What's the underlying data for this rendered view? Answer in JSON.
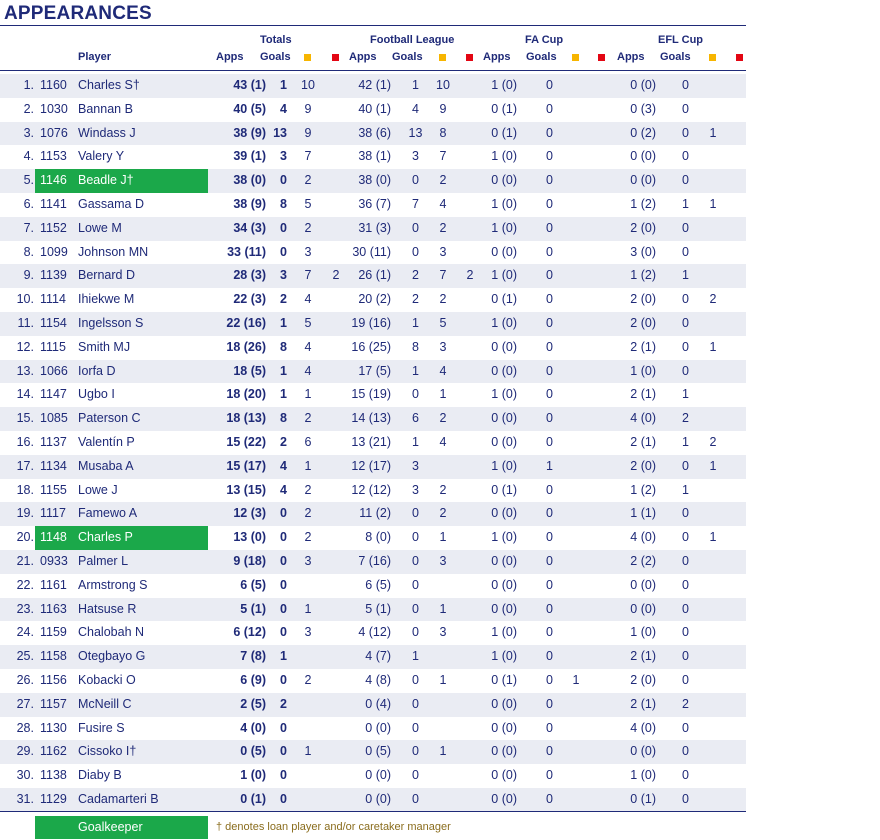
{
  "title": "APPEARANCES",
  "groups": {
    "totals": "Totals",
    "league": "Football League",
    "facup": "FA Cup",
    "eflcup": "EFL Cup"
  },
  "headers": {
    "player": "Player",
    "apps": "Apps",
    "goals": "Goals"
  },
  "colors": {
    "text": "#1f2a78",
    "goalkeeper": "#1ba84a",
    "alt_row": "#eaecf3",
    "yellow_card": "#f7b500",
    "red_card": "#e30613",
    "note": "#8a6d1e"
  },
  "legend": {
    "goalkeeper": "Goalkeeper",
    "note": "† denotes loan player and/or caretaker manager"
  },
  "rows": [
    {
      "num": "1.",
      "code": "1160",
      "player": "Charles S†",
      "gk": false,
      "t_apps": "43 (1)",
      "t_goals": "1",
      "t_y": "10",
      "t_r": "",
      "l_apps": "42 (1)",
      "l_goals": "1",
      "l_y": "10",
      "l_r": "",
      "f_apps": "1 (0)",
      "f_goals": "0",
      "f_y": "",
      "f_r": "",
      "e_apps": "0 (0)",
      "e_goals": "0",
      "e_y": "",
      "e_r": ""
    },
    {
      "num": "2.",
      "code": "1030",
      "player": "Bannan B",
      "gk": false,
      "t_apps": "40 (5)",
      "t_goals": "4",
      "t_y": "9",
      "t_r": "",
      "l_apps": "40 (1)",
      "l_goals": "4",
      "l_y": "9",
      "l_r": "",
      "f_apps": "0 (1)",
      "f_goals": "0",
      "f_y": "",
      "f_r": "",
      "e_apps": "0 (3)",
      "e_goals": "0",
      "e_y": "",
      "e_r": ""
    },
    {
      "num": "3.",
      "code": "1076",
      "player": "Windass J",
      "gk": false,
      "t_apps": "38 (9)",
      "t_goals": "13",
      "t_y": "9",
      "t_r": "",
      "l_apps": "38 (6)",
      "l_goals": "13",
      "l_y": "8",
      "l_r": "",
      "f_apps": "0 (1)",
      "f_goals": "0",
      "f_y": "",
      "f_r": "",
      "e_apps": "0 (2)",
      "e_goals": "0",
      "e_y": "1",
      "e_r": ""
    },
    {
      "num": "4.",
      "code": "1153",
      "player": "Valery Y",
      "gk": false,
      "t_apps": "39 (1)",
      "t_goals": "3",
      "t_y": "7",
      "t_r": "",
      "l_apps": "38 (1)",
      "l_goals": "3",
      "l_y": "7",
      "l_r": "",
      "f_apps": "1 (0)",
      "f_goals": "0",
      "f_y": "",
      "f_r": "",
      "e_apps": "0 (0)",
      "e_goals": "0",
      "e_y": "",
      "e_r": ""
    },
    {
      "num": "5.",
      "code": "1146",
      "player": "Beadle J†",
      "gk": true,
      "t_apps": "38 (0)",
      "t_goals": "0",
      "t_y": "2",
      "t_r": "",
      "l_apps": "38 (0)",
      "l_goals": "0",
      "l_y": "2",
      "l_r": "",
      "f_apps": "0 (0)",
      "f_goals": "0",
      "f_y": "",
      "f_r": "",
      "e_apps": "0 (0)",
      "e_goals": "0",
      "e_y": "",
      "e_r": ""
    },
    {
      "num": "6.",
      "code": "1141",
      "player": "Gassama D",
      "gk": false,
      "t_apps": "38 (9)",
      "t_goals": "8",
      "t_y": "5",
      "t_r": "",
      "l_apps": "36 (7)",
      "l_goals": "7",
      "l_y": "4",
      "l_r": "",
      "f_apps": "1 (0)",
      "f_goals": "0",
      "f_y": "",
      "f_r": "",
      "e_apps": "1 (2)",
      "e_goals": "1",
      "e_y": "1",
      "e_r": ""
    },
    {
      "num": "7.",
      "code": "1152",
      "player": "Lowe M",
      "gk": false,
      "t_apps": "34 (3)",
      "t_goals": "0",
      "t_y": "2",
      "t_r": "",
      "l_apps": "31 (3)",
      "l_goals": "0",
      "l_y": "2",
      "l_r": "",
      "f_apps": "1 (0)",
      "f_goals": "0",
      "f_y": "",
      "f_r": "",
      "e_apps": "2 (0)",
      "e_goals": "0",
      "e_y": "",
      "e_r": ""
    },
    {
      "num": "8.",
      "code": "1099",
      "player": "Johnson MN",
      "gk": false,
      "t_apps": "33 (11)",
      "t_goals": "0",
      "t_y": "3",
      "t_r": "",
      "l_apps": "30 (11)",
      "l_goals": "0",
      "l_y": "3",
      "l_r": "",
      "f_apps": "0 (0)",
      "f_goals": "0",
      "f_y": "",
      "f_r": "",
      "e_apps": "3 (0)",
      "e_goals": "0",
      "e_y": "",
      "e_r": ""
    },
    {
      "num": "9.",
      "code": "1139",
      "player": "Bernard D",
      "gk": false,
      "t_apps": "28 (3)",
      "t_goals": "3",
      "t_y": "7",
      "t_r": "2",
      "l_apps": "26 (1)",
      "l_goals": "2",
      "l_y": "7",
      "l_r": "2",
      "f_apps": "1 (0)",
      "f_goals": "0",
      "f_y": "",
      "f_r": "",
      "e_apps": "1 (2)",
      "e_goals": "1",
      "e_y": "",
      "e_r": ""
    },
    {
      "num": "10.",
      "code": "1114",
      "player": "Ihiekwe M",
      "gk": false,
      "t_apps": "22 (3)",
      "t_goals": "2",
      "t_y": "4",
      "t_r": "",
      "l_apps": "20 (2)",
      "l_goals": "2",
      "l_y": "2",
      "l_r": "",
      "f_apps": "0 (1)",
      "f_goals": "0",
      "f_y": "",
      "f_r": "",
      "e_apps": "2 (0)",
      "e_goals": "0",
      "e_y": "2",
      "e_r": ""
    },
    {
      "num": "11.",
      "code": "1154",
      "player": "Ingelsson S",
      "gk": false,
      "t_apps": "22 (16)",
      "t_goals": "1",
      "t_y": "5",
      "t_r": "",
      "l_apps": "19 (16)",
      "l_goals": "1",
      "l_y": "5",
      "l_r": "",
      "f_apps": "1 (0)",
      "f_goals": "0",
      "f_y": "",
      "f_r": "",
      "e_apps": "2 (0)",
      "e_goals": "0",
      "e_y": "",
      "e_r": ""
    },
    {
      "num": "12.",
      "code": "1115",
      "player": "Smith MJ",
      "gk": false,
      "t_apps": "18 (26)",
      "t_goals": "8",
      "t_y": "4",
      "t_r": "",
      "l_apps": "16 (25)",
      "l_goals": "8",
      "l_y": "3",
      "l_r": "",
      "f_apps": "0 (0)",
      "f_goals": "0",
      "f_y": "",
      "f_r": "",
      "e_apps": "2 (1)",
      "e_goals": "0",
      "e_y": "1",
      "e_r": ""
    },
    {
      "num": "13.",
      "code": "1066",
      "player": "Iorfa D",
      "gk": false,
      "t_apps": "18 (5)",
      "t_goals": "1",
      "t_y": "4",
      "t_r": "",
      "l_apps": "17 (5)",
      "l_goals": "1",
      "l_y": "4",
      "l_r": "",
      "f_apps": "0 (0)",
      "f_goals": "0",
      "f_y": "",
      "f_r": "",
      "e_apps": "1 (0)",
      "e_goals": "0",
      "e_y": "",
      "e_r": ""
    },
    {
      "num": "14.",
      "code": "1147",
      "player": "Ugbo I",
      "gk": false,
      "t_apps": "18 (20)",
      "t_goals": "1",
      "t_y": "1",
      "t_r": "",
      "l_apps": "15 (19)",
      "l_goals": "0",
      "l_y": "1",
      "l_r": "",
      "f_apps": "1 (0)",
      "f_goals": "0",
      "f_y": "",
      "f_r": "",
      "e_apps": "2 (1)",
      "e_goals": "1",
      "e_y": "",
      "e_r": ""
    },
    {
      "num": "15.",
      "code": "1085",
      "player": "Paterson C",
      "gk": false,
      "t_apps": "18 (13)",
      "t_goals": "8",
      "t_y": "2",
      "t_r": "",
      "l_apps": "14 (13)",
      "l_goals": "6",
      "l_y": "2",
      "l_r": "",
      "f_apps": "0 (0)",
      "f_goals": "0",
      "f_y": "",
      "f_r": "",
      "e_apps": "4 (0)",
      "e_goals": "2",
      "e_y": "",
      "e_r": ""
    },
    {
      "num": "16.",
      "code": "1137",
      "player": "Valentín P",
      "gk": false,
      "t_apps": "15 (22)",
      "t_goals": "2",
      "t_y": "6",
      "t_r": "",
      "l_apps": "13 (21)",
      "l_goals": "1",
      "l_y": "4",
      "l_r": "",
      "f_apps": "0 (0)",
      "f_goals": "0",
      "f_y": "",
      "f_r": "",
      "e_apps": "2 (1)",
      "e_goals": "1",
      "e_y": "2",
      "e_r": ""
    },
    {
      "num": "17.",
      "code": "1134",
      "player": "Musaba A",
      "gk": false,
      "t_apps": "15 (17)",
      "t_goals": "4",
      "t_y": "1",
      "t_r": "",
      "l_apps": "12 (17)",
      "l_goals": "3",
      "l_y": "",
      "l_r": "",
      "f_apps": "1 (0)",
      "f_goals": "1",
      "f_y": "",
      "f_r": "",
      "e_apps": "2 (0)",
      "e_goals": "0",
      "e_y": "1",
      "e_r": ""
    },
    {
      "num": "18.",
      "code": "1155",
      "player": "Lowe J",
      "gk": false,
      "t_apps": "13 (15)",
      "t_goals": "4",
      "t_y": "2",
      "t_r": "",
      "l_apps": "12 (12)",
      "l_goals": "3",
      "l_y": "2",
      "l_r": "",
      "f_apps": "0 (1)",
      "f_goals": "0",
      "f_y": "",
      "f_r": "",
      "e_apps": "1 (2)",
      "e_goals": "1",
      "e_y": "",
      "e_r": ""
    },
    {
      "num": "19.",
      "code": "1117",
      "player": "Famewo A",
      "gk": false,
      "t_apps": "12 (3)",
      "t_goals": "0",
      "t_y": "2",
      "t_r": "",
      "l_apps": "11 (2)",
      "l_goals": "0",
      "l_y": "2",
      "l_r": "",
      "f_apps": "0 (0)",
      "f_goals": "0",
      "f_y": "",
      "f_r": "",
      "e_apps": "1 (1)",
      "e_goals": "0",
      "e_y": "",
      "e_r": ""
    },
    {
      "num": "20.",
      "code": "1148",
      "player": "Charles P",
      "gk": true,
      "t_apps": "13 (0)",
      "t_goals": "0",
      "t_y": "2",
      "t_r": "",
      "l_apps": "8 (0)",
      "l_goals": "0",
      "l_y": "1",
      "l_r": "",
      "f_apps": "1 (0)",
      "f_goals": "0",
      "f_y": "",
      "f_r": "",
      "e_apps": "4 (0)",
      "e_goals": "0",
      "e_y": "1",
      "e_r": ""
    },
    {
      "num": "21.",
      "code": "0933",
      "player": "Palmer L",
      "gk": false,
      "t_apps": "9 (18)",
      "t_goals": "0",
      "t_y": "3",
      "t_r": "",
      "l_apps": "7 (16)",
      "l_goals": "0",
      "l_y": "3",
      "l_r": "",
      "f_apps": "0 (0)",
      "f_goals": "0",
      "f_y": "",
      "f_r": "",
      "e_apps": "2 (2)",
      "e_goals": "0",
      "e_y": "",
      "e_r": ""
    },
    {
      "num": "22.",
      "code": "1161",
      "player": "Armstrong S",
      "gk": false,
      "t_apps": "6 (5)",
      "t_goals": "0",
      "t_y": "",
      "t_r": "",
      "l_apps": "6 (5)",
      "l_goals": "0",
      "l_y": "",
      "l_r": "",
      "f_apps": "0 (0)",
      "f_goals": "0",
      "f_y": "",
      "f_r": "",
      "e_apps": "0 (0)",
      "e_goals": "0",
      "e_y": "",
      "e_r": ""
    },
    {
      "num": "23.",
      "code": "1163",
      "player": "Hatsuse R",
      "gk": false,
      "t_apps": "5 (1)",
      "t_goals": "0",
      "t_y": "1",
      "t_r": "",
      "l_apps": "5 (1)",
      "l_goals": "0",
      "l_y": "1",
      "l_r": "",
      "f_apps": "0 (0)",
      "f_goals": "0",
      "f_y": "",
      "f_r": "",
      "e_apps": "0 (0)",
      "e_goals": "0",
      "e_y": "",
      "e_r": ""
    },
    {
      "num": "24.",
      "code": "1159",
      "player": "Chalobah N",
      "gk": false,
      "t_apps": "6 (12)",
      "t_goals": "0",
      "t_y": "3",
      "t_r": "",
      "l_apps": "4 (12)",
      "l_goals": "0",
      "l_y": "3",
      "l_r": "",
      "f_apps": "1 (0)",
      "f_goals": "0",
      "f_y": "",
      "f_r": "",
      "e_apps": "1 (0)",
      "e_goals": "0",
      "e_y": "",
      "e_r": ""
    },
    {
      "num": "25.",
      "code": "1158",
      "player": "Otegbayo G",
      "gk": false,
      "t_apps": "7 (8)",
      "t_goals": "1",
      "t_y": "",
      "t_r": "",
      "l_apps": "4 (7)",
      "l_goals": "1",
      "l_y": "",
      "l_r": "",
      "f_apps": "1 (0)",
      "f_goals": "0",
      "f_y": "",
      "f_r": "",
      "e_apps": "2 (1)",
      "e_goals": "0",
      "e_y": "",
      "e_r": ""
    },
    {
      "num": "26.",
      "code": "1156",
      "player": "Kobacki O",
      "gk": false,
      "t_apps": "6 (9)",
      "t_goals": "0",
      "t_y": "2",
      "t_r": "",
      "l_apps": "4 (8)",
      "l_goals": "0",
      "l_y": "1",
      "l_r": "",
      "f_apps": "0 (1)",
      "f_goals": "0",
      "f_y": "1",
      "f_r": "",
      "e_apps": "2 (0)",
      "e_goals": "0",
      "e_y": "",
      "e_r": ""
    },
    {
      "num": "27.",
      "code": "1157",
      "player": "McNeill C",
      "gk": false,
      "t_apps": "2 (5)",
      "t_goals": "2",
      "t_y": "",
      "t_r": "",
      "l_apps": "0 (4)",
      "l_goals": "0",
      "l_y": "",
      "l_r": "",
      "f_apps": "0 (0)",
      "f_goals": "0",
      "f_y": "",
      "f_r": "",
      "e_apps": "2 (1)",
      "e_goals": "2",
      "e_y": "",
      "e_r": ""
    },
    {
      "num": "28.",
      "code": "1130",
      "player": "Fusire S",
      "gk": false,
      "t_apps": "4 (0)",
      "t_goals": "0",
      "t_y": "",
      "t_r": "",
      "l_apps": "0 (0)",
      "l_goals": "0",
      "l_y": "",
      "l_r": "",
      "f_apps": "0 (0)",
      "f_goals": "0",
      "f_y": "",
      "f_r": "",
      "e_apps": "4 (0)",
      "e_goals": "0",
      "e_y": "",
      "e_r": ""
    },
    {
      "num": "29.",
      "code": "1162",
      "player": "Cissoko I†",
      "gk": false,
      "t_apps": "0 (5)",
      "t_goals": "0",
      "t_y": "1",
      "t_r": "",
      "l_apps": "0 (5)",
      "l_goals": "0",
      "l_y": "1",
      "l_r": "",
      "f_apps": "0 (0)",
      "f_goals": "0",
      "f_y": "",
      "f_r": "",
      "e_apps": "0 (0)",
      "e_goals": "0",
      "e_y": "",
      "e_r": ""
    },
    {
      "num": "30.",
      "code": "1138",
      "player": "Diaby B",
      "gk": false,
      "t_apps": "1 (0)",
      "t_goals": "0",
      "t_y": "",
      "t_r": "",
      "l_apps": "0 (0)",
      "l_goals": "0",
      "l_y": "",
      "l_r": "",
      "f_apps": "0 (0)",
      "f_goals": "0",
      "f_y": "",
      "f_r": "",
      "e_apps": "1 (0)",
      "e_goals": "0",
      "e_y": "",
      "e_r": ""
    },
    {
      "num": "31.",
      "code": "1129",
      "player": "Cadamarteri B",
      "gk": false,
      "t_apps": "0 (1)",
      "t_goals": "0",
      "t_y": "",
      "t_r": "",
      "l_apps": "0 (0)",
      "l_goals": "0",
      "l_y": "",
      "l_r": "",
      "f_apps": "0 (0)",
      "f_goals": "0",
      "f_y": "",
      "f_r": "",
      "e_apps": "0 (1)",
      "e_goals": "0",
      "e_y": "",
      "e_r": ""
    }
  ]
}
